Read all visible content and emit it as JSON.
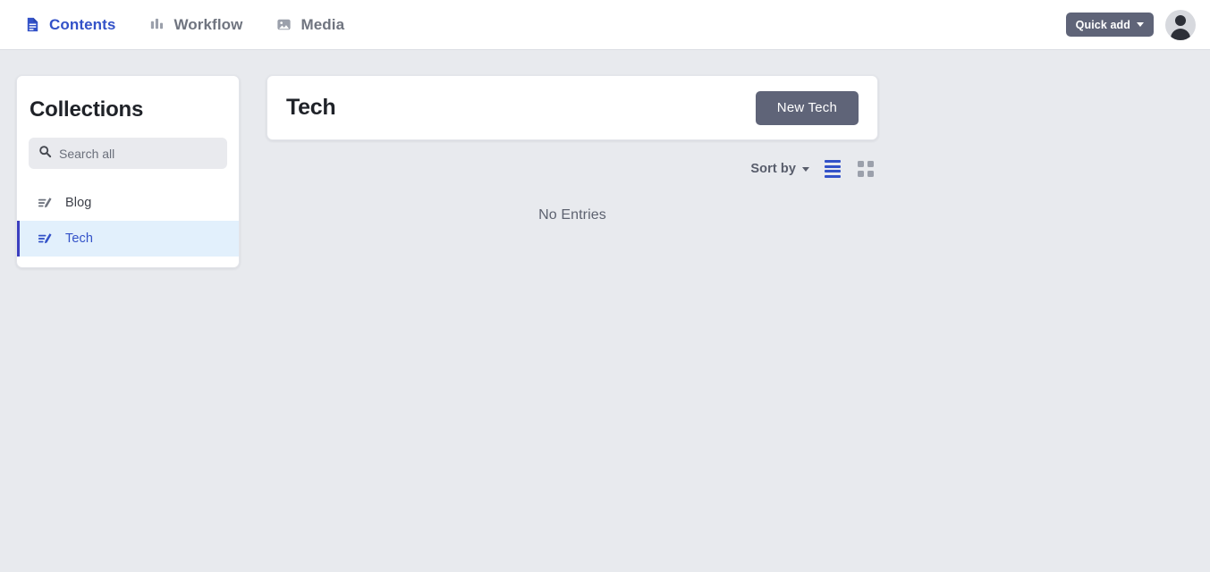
{
  "topbar": {
    "nav": [
      {
        "label": "Contents",
        "icon": "document-icon",
        "active": true
      },
      {
        "label": "Workflow",
        "icon": "bar-chart-icon",
        "active": false
      },
      {
        "label": "Media",
        "icon": "image-icon",
        "active": false
      }
    ],
    "quick_add_label": "Quick add",
    "quick_add_caret": "caret-down-icon",
    "avatar": "user-avatar"
  },
  "sidebar": {
    "title": "Collections",
    "search": {
      "placeholder": "Search all",
      "value": "",
      "icon": "search-icon"
    },
    "items": [
      {
        "label": "Blog",
        "icon": "compose-icon",
        "active": false
      },
      {
        "label": "Tech",
        "icon": "compose-icon",
        "active": true
      }
    ]
  },
  "main": {
    "card_title": "Tech",
    "new_button_label": "New Tech",
    "toolbar": {
      "sort_label": "Sort by",
      "sort_caret": "caret-down-icon",
      "list_view": {
        "name": "list-view-icon",
        "active": true
      },
      "grid_view": {
        "name": "grid-view-icon",
        "active": false
      }
    },
    "empty_state": "No Entries"
  },
  "colors": {
    "accent_blue": "#3352c8",
    "active_row_bg": "#e2f0fc",
    "active_row_border": "#3c3fbf",
    "button_slate": "#5f6478",
    "page_bg": "#e8eaee",
    "muted_text": "#6f747f"
  }
}
